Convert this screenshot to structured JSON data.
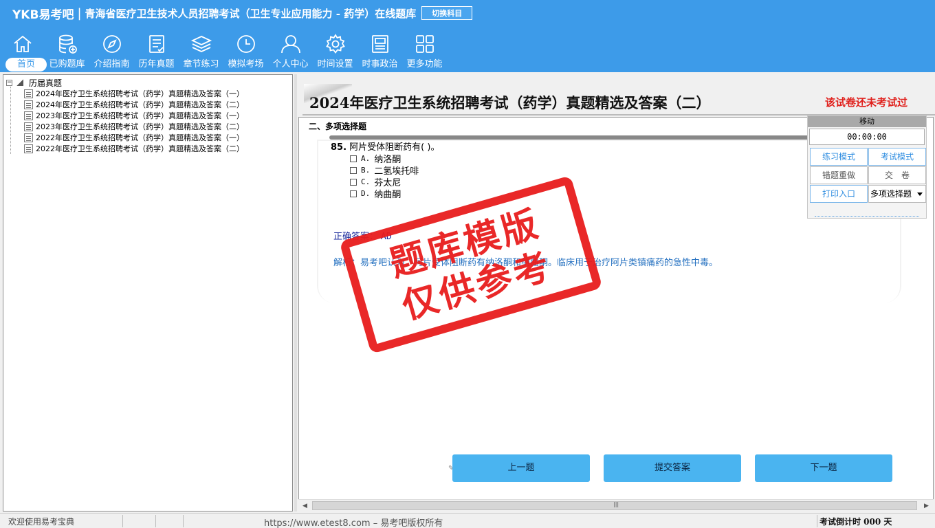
{
  "header": {
    "logo": "YKB易考吧",
    "title": "青海省医疗卫生技术人员招聘考试（卫生专业应用能力 - 药学）在线题库",
    "switch_label": "切换科目"
  },
  "nav": [
    {
      "label": "首页",
      "icon": "home-icon",
      "active": true
    },
    {
      "label": "已购题库",
      "icon": "database-icon"
    },
    {
      "label": "介绍指南",
      "icon": "compass-icon"
    },
    {
      "label": "历年真题",
      "icon": "document-list-icon"
    },
    {
      "label": "章节练习",
      "icon": "layers-icon"
    },
    {
      "label": "模拟考场",
      "icon": "clock-icon"
    },
    {
      "label": "个人中心",
      "icon": "user-icon"
    },
    {
      "label": "时间设置",
      "icon": "gear-icon"
    },
    {
      "label": "时事政治",
      "icon": "newspaper-icon"
    },
    {
      "label": "更多功能",
      "icon": "grid-icon"
    }
  ],
  "tree": {
    "root": "历届真题",
    "items": [
      "2024年医疗卫生系统招聘考试（药学）真题精选及答案（一）",
      "2024年医疗卫生系统招聘考试（药学）真题精选及答案（二）",
      "2023年医疗卫生系统招聘考试（药学）真题精选及答案（一）",
      "2023年医疗卫生系统招聘考试（药学）真题精选及答案（二）",
      "2022年医疗卫生系统招聘考试（药学）真题精选及答案（一）",
      "2022年医疗卫生系统招聘考试（药学）真题精选及答案（二）"
    ]
  },
  "paper": {
    "title": "2024年医疗卫生系统招聘考试（药学）真题精选及答案（二）",
    "status": "该试卷还未考试过"
  },
  "question": {
    "section": "二、多项选择题",
    "number": "85.",
    "stem": "阿片受体阻断药有( )。",
    "options": [
      {
        "letter": "A.",
        "text": "纳洛酮"
      },
      {
        "letter": "B.",
        "text": "二氢埃托啡"
      },
      {
        "letter": "C.",
        "text": "芬太尼"
      },
      {
        "letter": "D.",
        "text": "纳曲酮"
      }
    ],
    "answer_label": "正确答案：",
    "answer_value": "AD",
    "analysis": "解析：易考吧认为，阿片受体阻断药有纳洛酮和纳曲酮。临床用于治疗阿片类镇痛药的急性中毒。"
  },
  "control": {
    "move_label": "移动",
    "timer": "00:00:00",
    "practice_mode": "练习模式",
    "exam_mode": "考试模式",
    "redo_wrong": "错题重做",
    "submit_paper": "交　卷",
    "print_entry": "打印入口",
    "type_select": "多项选择题"
  },
  "actions": {
    "prev": "上一题",
    "submit": "提交答案",
    "next": "下一题"
  },
  "status": {
    "welcome": "欢迎使用易考宝典",
    "copyright": "https://www.etest8.com – 易考吧版权所有",
    "countdown": "考试倒计时 000 天"
  },
  "watermark": {
    "line1": "题库模版",
    "line2": "仅供参考"
  },
  "colors": {
    "header": "#3d9be9",
    "button": "#4ab4f0",
    "stamp": "#e81d1d",
    "status_red": "#e0211d"
  }
}
